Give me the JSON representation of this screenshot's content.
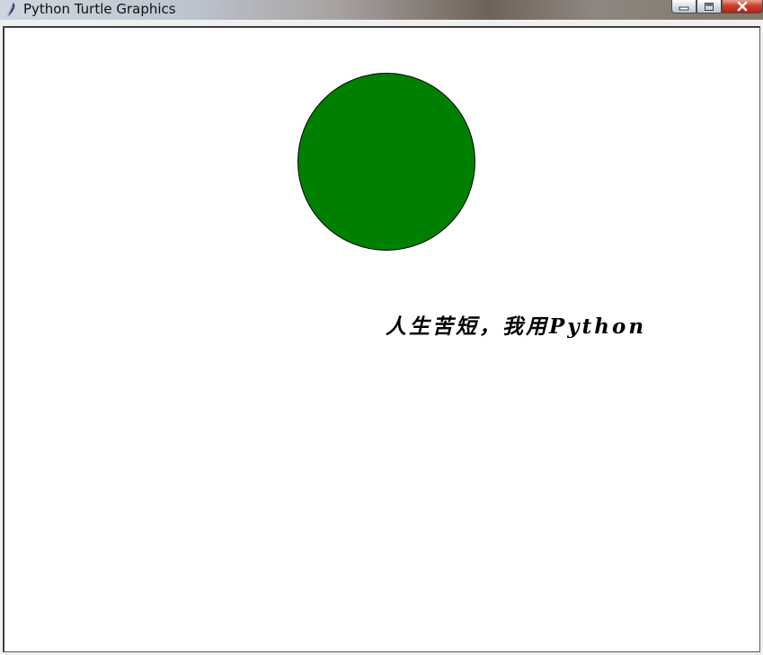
{
  "window": {
    "title": "Python Turtle Graphics",
    "icon": "feather-icon",
    "controls": {
      "minimize_icon": "minimize-icon",
      "maximize_icon": "maximize-icon",
      "close_icon": "close-icon"
    }
  },
  "canvas": {
    "background_color": "#ffffff",
    "shape": {
      "type": "circle",
      "fill_color": "#008000",
      "outline_color": "#000000"
    },
    "text": "人生苦短，我用Python"
  }
}
